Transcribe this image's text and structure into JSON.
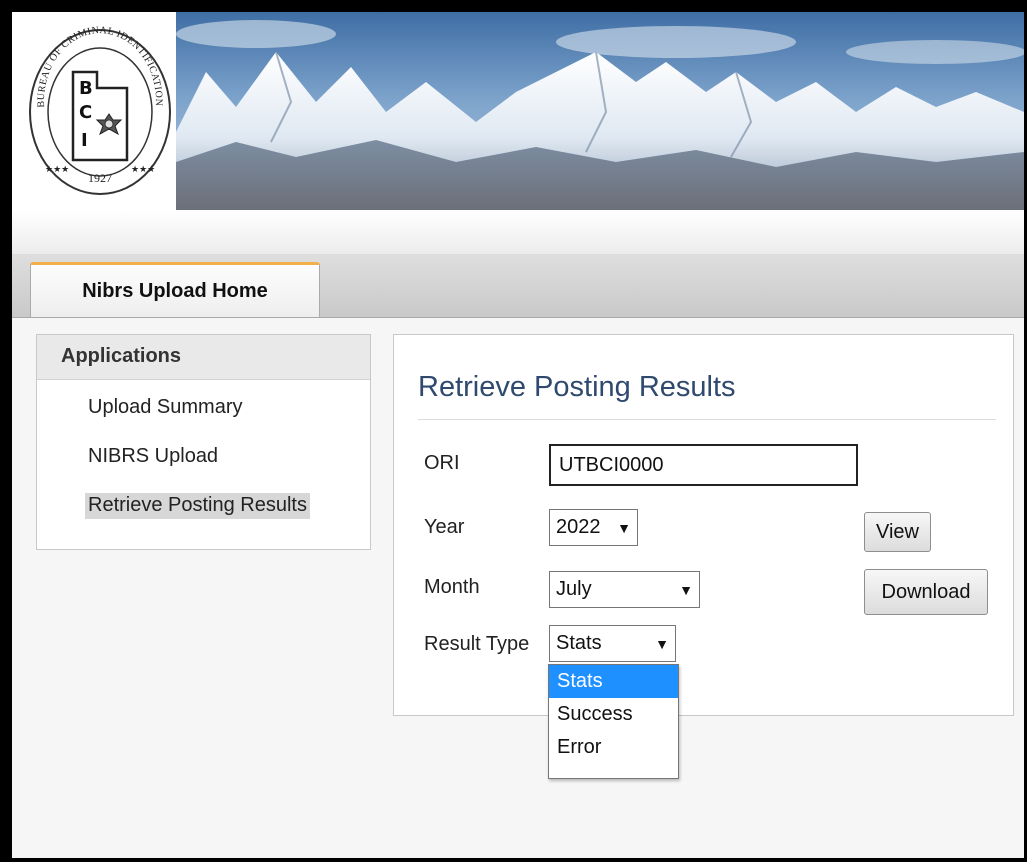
{
  "header": {
    "seal_text": "BUREAU OF CRIMINAL IDENTIFICATION",
    "seal_initials": [
      "B",
      "C",
      "I"
    ],
    "seal_year": "1927"
  },
  "tabs": [
    {
      "label": "Nibrs Upload Home",
      "active": true
    }
  ],
  "sidebar": {
    "title": "Applications",
    "items": [
      {
        "label": "Upload Summary"
      },
      {
        "label": "NIBRS Upload"
      },
      {
        "label": "Retrieve Posting Results",
        "active": true
      }
    ]
  },
  "form": {
    "title": "Retrieve Posting Results",
    "ori_label": "ORI",
    "ori_value": "UTBCI0000",
    "year_label": "Year",
    "year_value": "2022",
    "month_label": "Month",
    "month_value": "July",
    "result_type_label": "Result Type",
    "result_type_value": "Stats",
    "result_type_options": [
      "Stats",
      "Success",
      "Error"
    ],
    "view_button": "View",
    "download_button": "Download"
  },
  "colors": {
    "accent_tab": "#f2b04a",
    "title_blue": "#2f4a6e",
    "dropdown_selected": "#1e90ff"
  }
}
